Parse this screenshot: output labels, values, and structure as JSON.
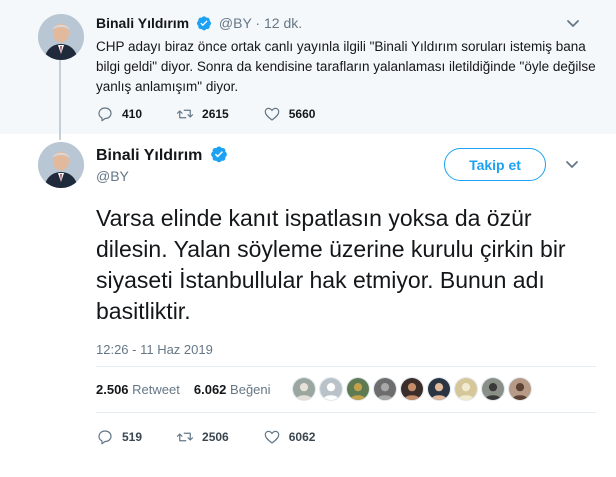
{
  "parent_tweet": {
    "name": "Binali Yıldırım",
    "handle": "@BY",
    "separator": "·",
    "time": "12 dk.",
    "text": "CHP adayı biraz önce ortak canlı yayınla ilgili \"Binali Yıldırım soruları istemiş bana bilgi geldi\" diyor. Sonra da kendisine tarafların yalanlaması iletildiğinde \"öyle değilse yanlış anlamışım\" diyor.",
    "replies": "410",
    "retweets": "2615",
    "likes": "5660"
  },
  "main_tweet": {
    "name": "Binali Yıldırım",
    "handle": "@BY",
    "follow_label": "Takip et",
    "text": "Varsa elinde kanıt ispatlasın yoksa da özür dilesin. Yalan söyleme üzerine kurulu çirkin bir siyaseti İstanbullular hak etmiyor. Bunun adı basitliktir.",
    "timestamp": "12:26 - 11 Haz 2019",
    "retweet_count": "2.506",
    "retweet_label": "Retweet",
    "like_count": "6.062",
    "like_label": "Beğeni",
    "replies": "519",
    "retweets": "2506",
    "likes": "6062",
    "liker_avatar_count": 9
  },
  "colors": {
    "accent": "#1da1f2",
    "muted": "#657786",
    "parent_background": "#f5f8fa"
  },
  "icons": [
    "verified-badge-icon",
    "chevron-down-icon",
    "reply-icon",
    "retweet-icon",
    "like-icon"
  ]
}
